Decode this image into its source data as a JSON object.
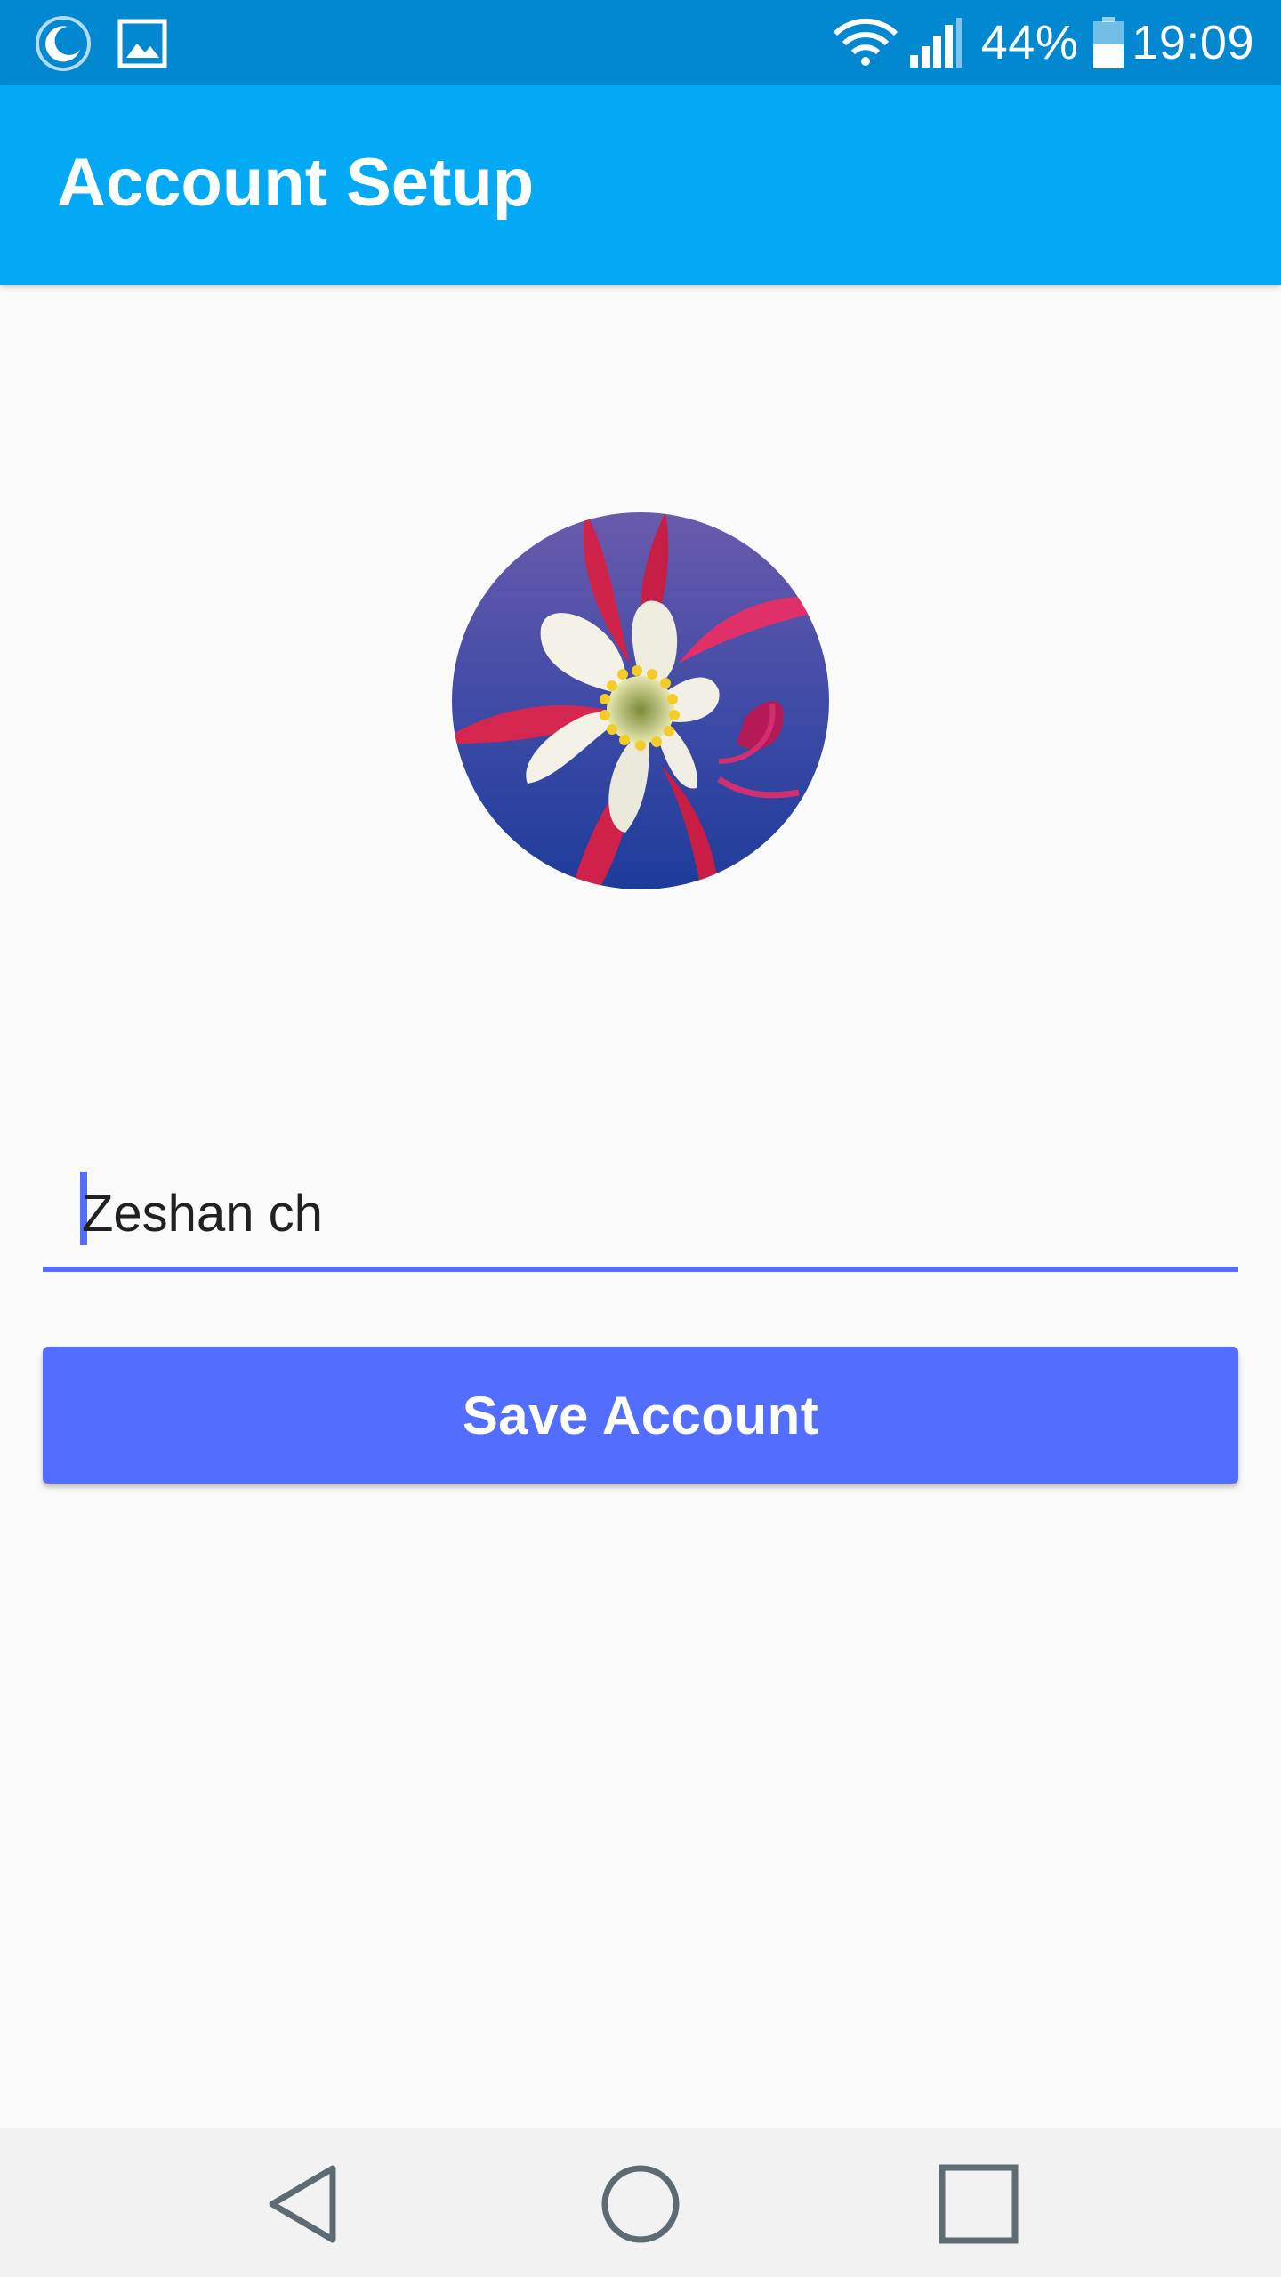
{
  "status_bar": {
    "left_icons": [
      "night-mode-icon",
      "image-icon"
    ],
    "right_icons": [
      "wifi-icon",
      "cell-signal-icon",
      "battery-icon"
    ],
    "battery_percent": "44%",
    "time": "19:09"
  },
  "app_bar": {
    "title": "Account Setup"
  },
  "avatar": {
    "image": "flower-photo"
  },
  "form": {
    "name_value": "Zeshan ch",
    "save_label": "Save Account"
  },
  "nav_bar": {
    "icons": [
      "back-icon",
      "home-icon",
      "recents-icon"
    ]
  },
  "colors": {
    "status_bar": "#0288d1",
    "app_bar": "#03a9f4",
    "accent": "#536dfe",
    "background": "#fafafa"
  }
}
